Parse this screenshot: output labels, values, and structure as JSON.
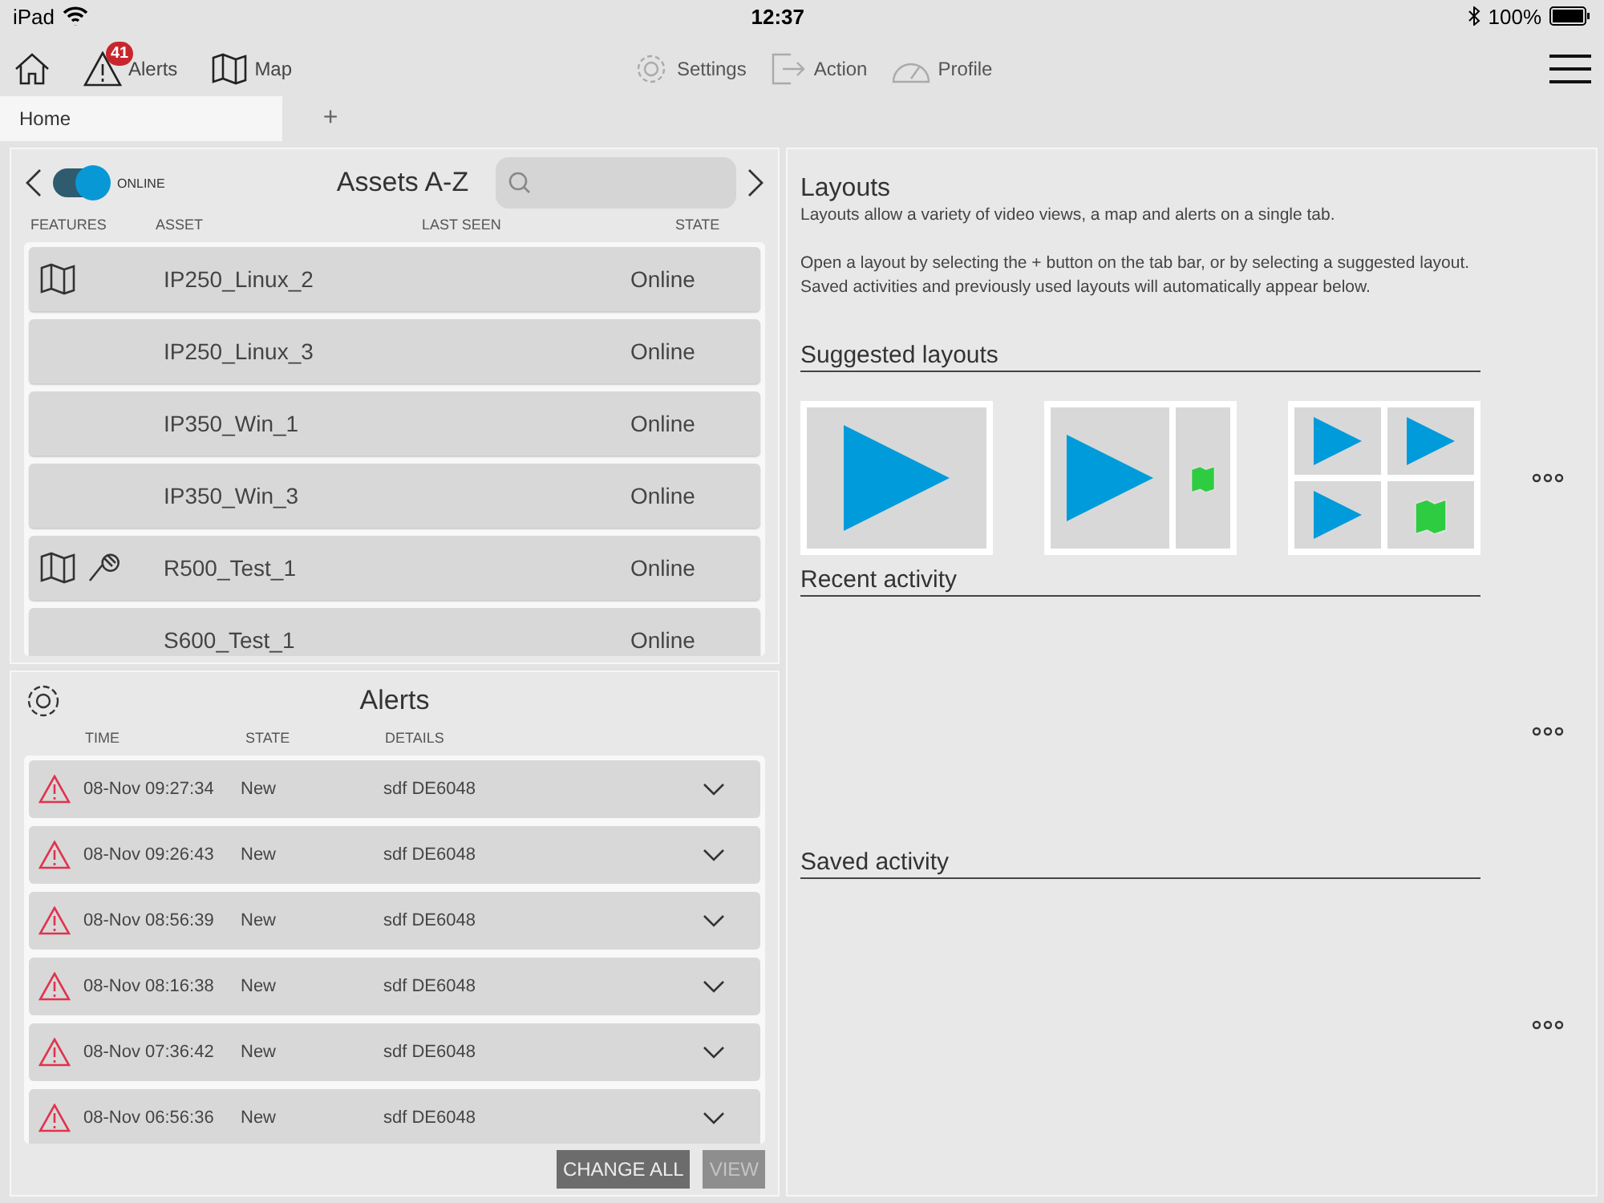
{
  "status_bar": {
    "device": "iPad",
    "time": "12:37",
    "battery": "100%"
  },
  "toolbar": {
    "left": [
      {
        "kind": "home",
        "disabled": false
      },
      {
        "kind": "alerts",
        "label": "Alerts",
        "badge": "41",
        "disabled": false
      },
      {
        "kind": "map",
        "label": "Map",
        "disabled": false
      }
    ],
    "center": [
      {
        "kind": "settings",
        "label": "Settings",
        "disabled": true
      },
      {
        "kind": "action",
        "label": "Action",
        "disabled": true
      },
      {
        "kind": "profile",
        "label": "Profile",
        "disabled": true
      }
    ]
  },
  "tabs": [
    {
      "label": "Home",
      "selected": true
    },
    {
      "label": "+",
      "selected": false
    }
  ],
  "assets": {
    "title": "Assets A-Z",
    "toggle": {
      "label": "ONLINE",
      "on": true
    },
    "columns": [
      "FEATURES",
      "ASSET",
      "LAST SEEN",
      "STATE"
    ],
    "rows": [
      {
        "features": [
          {
            "kind": "map"
          }
        ],
        "asset": "IP250_Linux_2",
        "state": "Online"
      },
      {
        "features": [],
        "asset": "IP250_Linux_3",
        "state": "Online"
      },
      {
        "features": [],
        "asset": "IP350_Win_1",
        "state": "Online"
      },
      {
        "features": [],
        "asset": "IP350_Win_3",
        "state": "Online"
      },
      {
        "features": [
          {
            "kind": "map"
          },
          {
            "kind": "mic"
          }
        ],
        "asset": "R500_Test_1",
        "state": "Online"
      },
      {
        "features": [],
        "asset": "S600_Test_1",
        "state": "Online"
      }
    ]
  },
  "alerts": {
    "title": "Alerts",
    "columns": [
      "TIME",
      "STATE",
      "DETAILS"
    ],
    "rows": [
      {
        "time": "08-Nov 09:27:34",
        "state": "New",
        "details": "sdf DE6048",
        "expanded": false
      },
      {
        "time": "08-Nov 09:26:43",
        "state": "New",
        "details": "sdf DE6048",
        "expanded": false
      },
      {
        "time": "08-Nov 08:56:39",
        "state": "New",
        "details": "sdf DE6048",
        "expanded": false
      },
      {
        "time": "08-Nov 08:16:38",
        "state": "New",
        "details": "sdf DE6048",
        "expanded": false
      },
      {
        "time": "08-Nov 07:36:42",
        "state": "New",
        "details": "sdf DE6048",
        "expanded": false
      },
      {
        "time": "08-Nov 06:56:36",
        "state": "New",
        "details": "sdf DE6048",
        "expanded": false
      }
    ],
    "buttons": [
      {
        "label": "CHANGE ALL",
        "disabled": false
      },
      {
        "label": "VIEW",
        "disabled": true
      }
    ]
  },
  "layouts": {
    "title": "Layouts",
    "intro": "Layouts allow a variety of video views, a map and alerts on a single tab.",
    "help": [
      "Open a layout by selecting the + button on the tab bar, or by selecting a suggested layout.",
      "Saved activities and previously used layouts will automatically appear below."
    ],
    "sections": [
      {
        "title": "Suggested layouts",
        "layouts": [
          {
            "kind": "single"
          },
          {
            "kind": "video-map"
          },
          {
            "kind": "quad"
          }
        ]
      },
      {
        "title": "Recent activity"
      },
      {
        "title": "Saved activity"
      }
    ]
  }
}
